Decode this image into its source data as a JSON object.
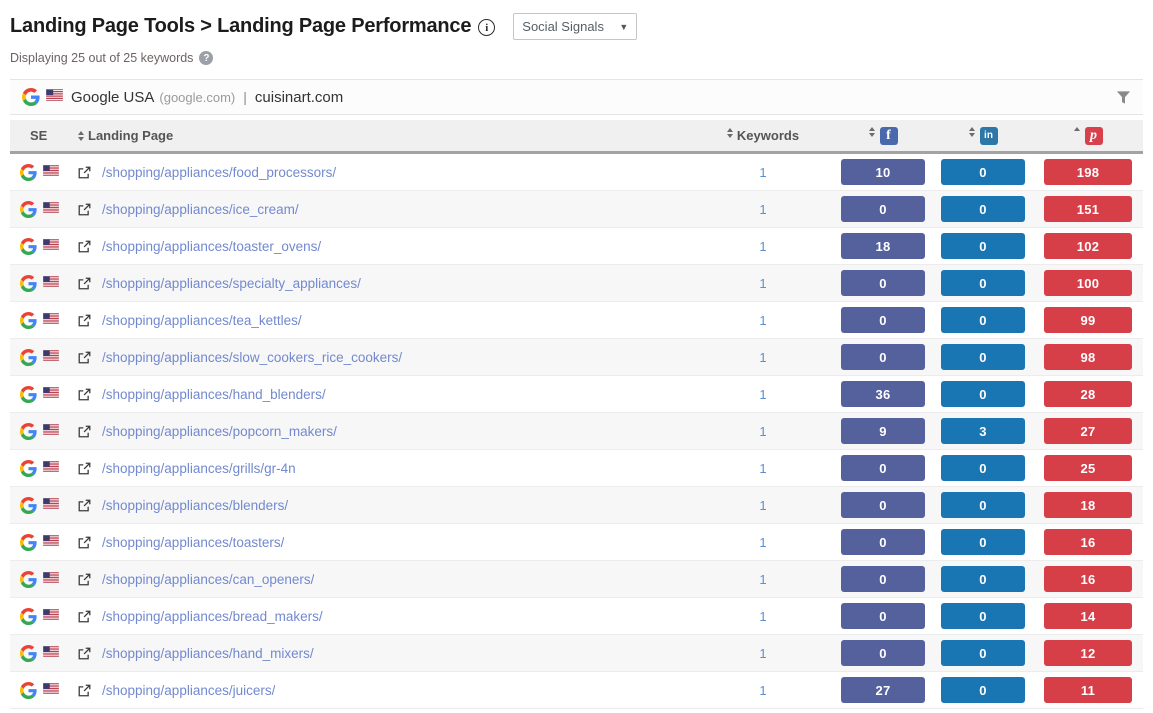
{
  "header": {
    "title": "Landing Page Tools > Landing Page Performance",
    "subtitle": "Displaying 25 out of 25 keywords",
    "dropdown": {
      "selected": "Social Signals"
    }
  },
  "domain_bar": {
    "search_engine": "Google USA",
    "search_engine_domain": "(google.com)",
    "separator": "|",
    "site": "cuisinart.com"
  },
  "table": {
    "columns": {
      "se": "SE",
      "landing_page": "Landing Page",
      "keywords": "Keywords"
    },
    "social_icons": {
      "facebook": "f",
      "linkedin": "in",
      "pinterest": "p"
    },
    "rows": [
      {
        "landing_page": "/shopping/appliances/food_processors/",
        "keywords": "1",
        "facebook": "10",
        "linkedin": "0",
        "pinterest": "198"
      },
      {
        "landing_page": "/shopping/appliances/ice_cream/",
        "keywords": "1",
        "facebook": "0",
        "linkedin": "0",
        "pinterest": "151"
      },
      {
        "landing_page": "/shopping/appliances/toaster_ovens/",
        "keywords": "1",
        "facebook": "18",
        "linkedin": "0",
        "pinterest": "102"
      },
      {
        "landing_page": "/shopping/appliances/specialty_appliances/",
        "keywords": "1",
        "facebook": "0",
        "linkedin": "0",
        "pinterest": "100"
      },
      {
        "landing_page": "/shopping/appliances/tea_kettles/",
        "keywords": "1",
        "facebook": "0",
        "linkedin": "0",
        "pinterest": "99"
      },
      {
        "landing_page": "/shopping/appliances/slow_cookers_rice_cookers/",
        "keywords": "1",
        "facebook": "0",
        "linkedin": "0",
        "pinterest": "98"
      },
      {
        "landing_page": "/shopping/appliances/hand_blenders/",
        "keywords": "1",
        "facebook": "36",
        "linkedin": "0",
        "pinterest": "28"
      },
      {
        "landing_page": "/shopping/appliances/popcorn_makers/",
        "keywords": "1",
        "facebook": "9",
        "linkedin": "3",
        "pinterest": "27"
      },
      {
        "landing_page": "/shopping/appliances/grills/gr-4n",
        "keywords": "1",
        "facebook": "0",
        "linkedin": "0",
        "pinterest": "25"
      },
      {
        "landing_page": "/shopping/appliances/blenders/",
        "keywords": "1",
        "facebook": "0",
        "linkedin": "0",
        "pinterest": "18"
      },
      {
        "landing_page": "/shopping/appliances/toasters/",
        "keywords": "1",
        "facebook": "0",
        "linkedin": "0",
        "pinterest": "16"
      },
      {
        "landing_page": "/shopping/appliances/can_openers/",
        "keywords": "1",
        "facebook": "0",
        "linkedin": "0",
        "pinterest": "16"
      },
      {
        "landing_page": "/shopping/appliances/bread_makers/",
        "keywords": "1",
        "facebook": "0",
        "linkedin": "0",
        "pinterest": "14"
      },
      {
        "landing_page": "/shopping/appliances/hand_mixers/",
        "keywords": "1",
        "facebook": "0",
        "linkedin": "0",
        "pinterest": "12"
      },
      {
        "landing_page": "/shopping/appliances/juicers/",
        "keywords": "1",
        "facebook": "27",
        "linkedin": "0",
        "pinterest": "11"
      }
    ]
  },
  "colors": {
    "facebook_badge": "#55619d",
    "linkedin_badge": "#1a76b2",
    "pinterest_badge": "#d63e48",
    "link": "#7289cf",
    "keyword_link": "#5a8fd3"
  }
}
